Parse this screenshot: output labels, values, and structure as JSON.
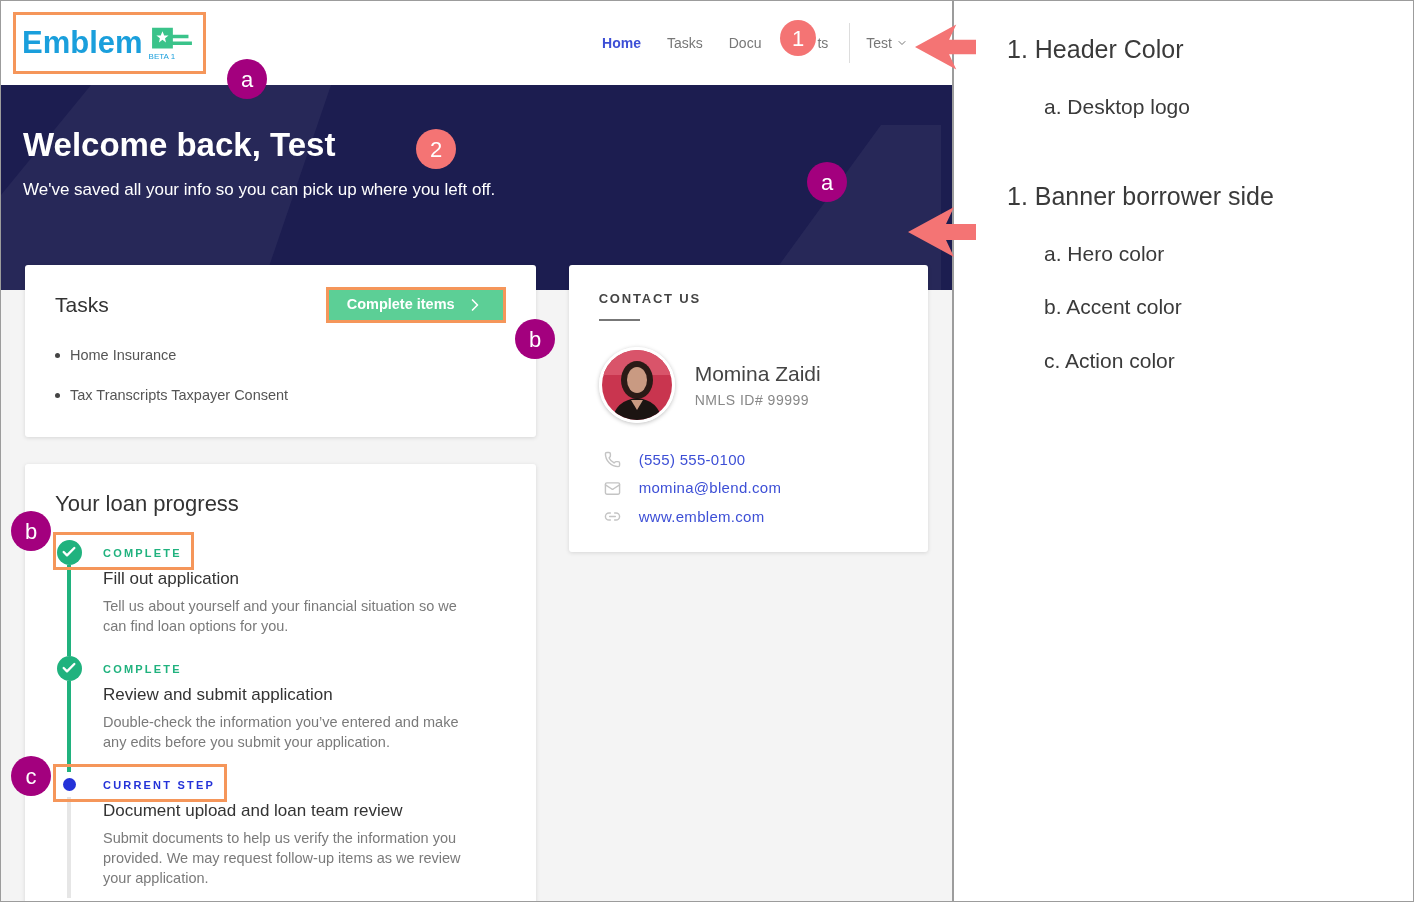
{
  "header": {
    "logo": {
      "text": "Emblem",
      "badge": "BETA 1",
      "highlighted": true
    },
    "nav": [
      {
        "label": "Home",
        "selected": true
      },
      {
        "label": "Tasks",
        "selected": false
      },
      {
        "label": "Docu",
        "label_tail": "ts",
        "selected": false
      }
    ],
    "user_menu": {
      "label": "Test"
    }
  },
  "banner": {
    "title": "Welcome back, Test",
    "subtitle": "We've saved all your info so you can pick up where you left off."
  },
  "tasks_card": {
    "title": "Tasks",
    "button": {
      "label": "Complete items",
      "highlighted": true
    },
    "items": [
      "Home Insurance",
      "Tax Transcripts Taxpayer Consent"
    ]
  },
  "loan_progress": {
    "title": "Your loan progress",
    "steps": [
      {
        "kind": "complete",
        "status": "COMPLETE",
        "title": "Fill out application",
        "description": "Tell us about yourself and your financial situation so we can find loan options for you.",
        "highlighted": true
      },
      {
        "kind": "complete",
        "status": "COMPLETE",
        "title": "Review and submit application",
        "description": "Double-check the information you’ve entered and make any edits before you submit your application.",
        "highlighted": false
      },
      {
        "kind": "current",
        "status": "CURRENT STEP",
        "title": "Document upload and loan team review",
        "description": "Submit documents to help us verify the information you provided. We may request follow-up items as we review your application.",
        "highlighted": true
      }
    ]
  },
  "contact_card": {
    "title": "CONTACT US",
    "name": "Momina Zaidi",
    "nmls": "NMLS ID# 99999",
    "links": [
      {
        "kind": "phone",
        "text": "(555) 555-0100"
      },
      {
        "kind": "email",
        "text": "momina@blend.com"
      },
      {
        "kind": "web",
        "text": "www.emblem.com"
      }
    ]
  },
  "markers": [
    {
      "label": "a",
      "color": "#a3007e"
    },
    {
      "label": "1",
      "color": "#f47474"
    },
    {
      "label": "2",
      "color": "#f47474"
    },
    {
      "label": "a",
      "color": "#a3007e"
    },
    {
      "label": "b",
      "color": "#a3007e"
    },
    {
      "label": "b",
      "color": "#a3007e"
    },
    {
      "label": "c",
      "color": "#a3007e"
    }
  ],
  "notes": [
    {
      "text": "1. Header Color",
      "children": [
        {
          "text": "a. Desktop logo"
        }
      ]
    },
    {
      "text": "1. Banner borrower side",
      "children": [
        {
          "text": "a. Hero color"
        },
        {
          "text": "b. Accent color"
        },
        {
          "text": "c. Action color"
        }
      ]
    }
  ]
}
